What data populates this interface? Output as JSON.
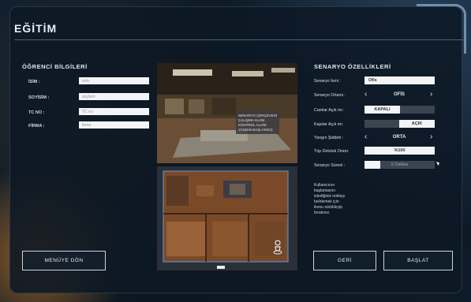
{
  "header": {
    "title": "EĞİTİM"
  },
  "student": {
    "section_title": "ÖĞRENCİ BİLGİLERİ",
    "fields": [
      {
        "label": "İSİM :",
        "value": "isim"
      },
      {
        "label": "SOYİSİM :",
        "value": "soyisim"
      },
      {
        "label": "TC NO :",
        "value": "TC no"
      },
      {
        "label": "FİRMA :",
        "value": "firma"
      }
    ]
  },
  "preview": {
    "overlay_lines": [
      "SENARYO ÇERÇEVESİ",
      "ÇALIŞMA ALANI",
      "KONTROL ALANI",
      "YANGIN BAŞLANGIÇ"
    ]
  },
  "scenario": {
    "section_title": "SENARYO ÖZELLİKLERİ",
    "name_label": "Senaryo İsmi :",
    "name_value": "Ofis",
    "env_label": "Senaryo Ortamı :",
    "env_value": "OFİS",
    "windows_label": "Camlar Açık mı:",
    "windows_value": "KAPALI",
    "doors_label": "Kapılar Açık mı:",
    "doors_value": "AÇIK",
    "fire_label": "Yangın Şiddeti :",
    "fire_value": "ORTA",
    "smoke_label": "Tüp Doluluk Oranı:",
    "smoke_value": "%100",
    "duration_label": "Senaryo Süresi :",
    "duration_value": "5 Dakika",
    "help_text": "Kullanıcının başlamasını istediğiniz noktayı belirlemek için ikonu sürükleyip bırakınız."
  },
  "buttons": {
    "menu": "MENÜYE DÖN",
    "back": "GERİ",
    "start": "BAŞLAT"
  },
  "icons": {
    "left_arrow": "‹",
    "right_arrow": "›"
  }
}
